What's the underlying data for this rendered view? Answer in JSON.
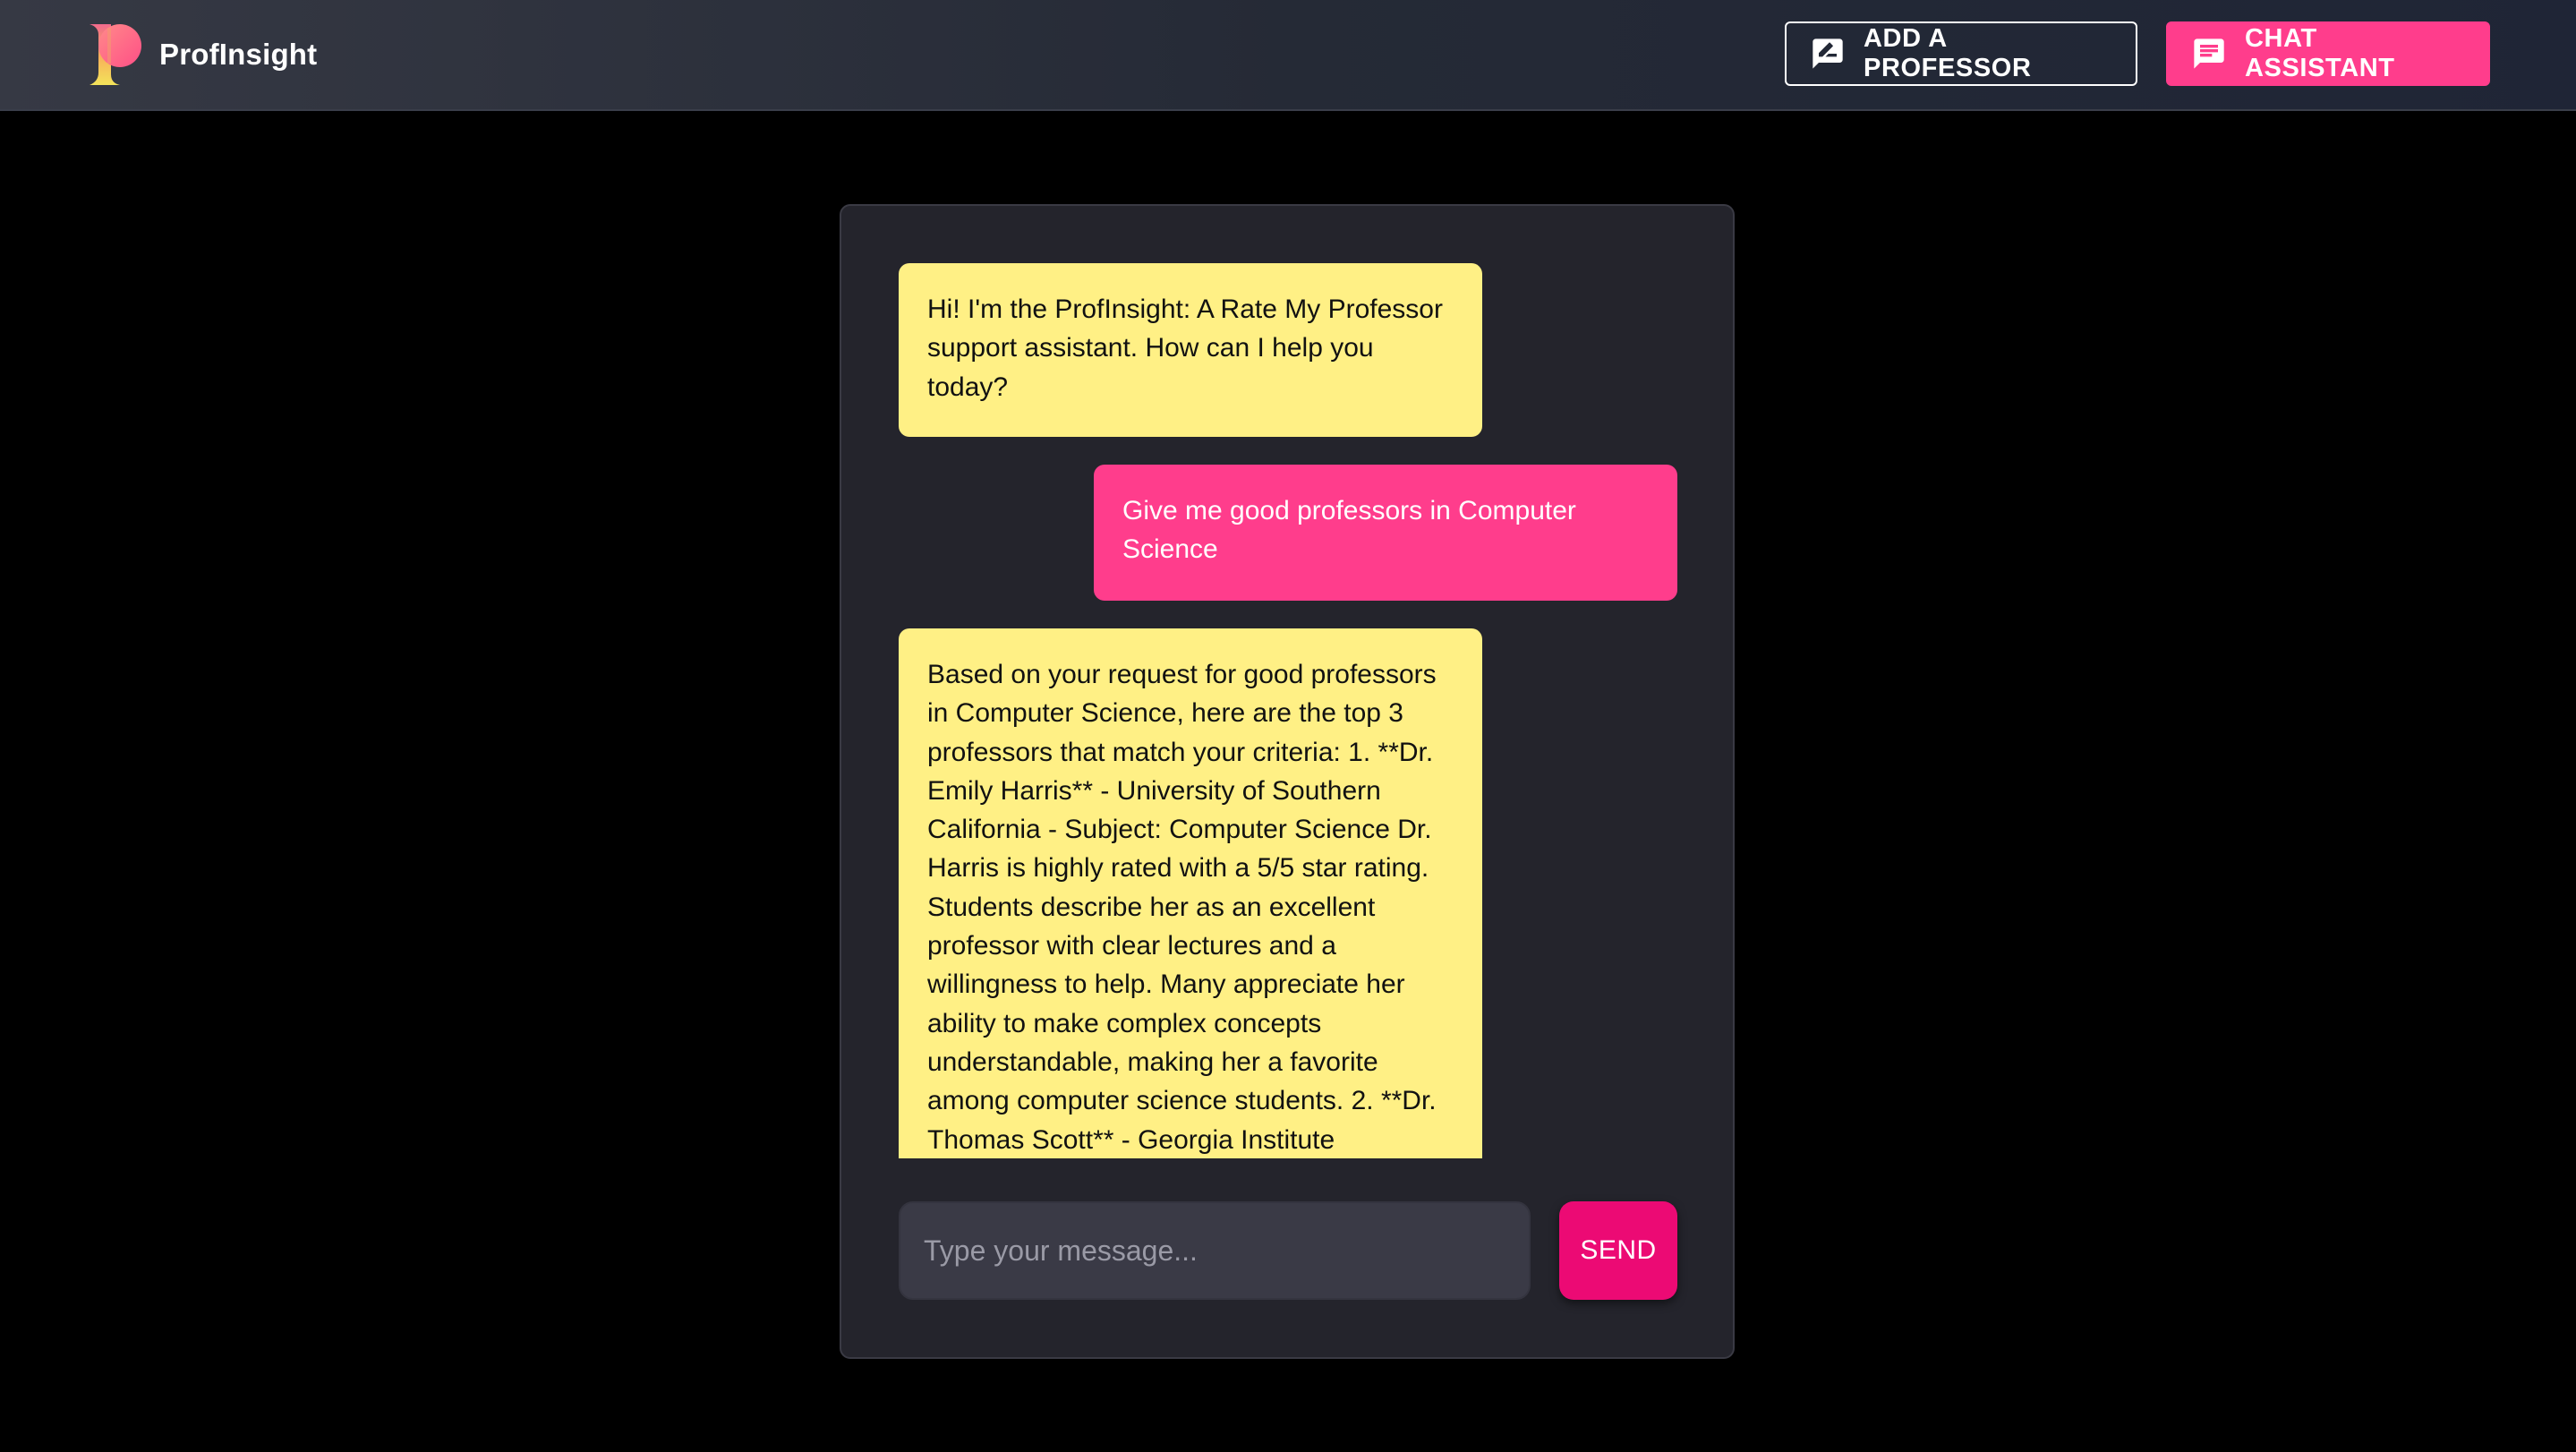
{
  "navbar": {
    "brand_name": "ProfInsight",
    "add_professor_label": "ADD A PROFESSOR",
    "chat_assistant_label": "CHAT ASSISTANT",
    "accent_color": "#ff3d8c",
    "icons": {
      "logo": "profinsight-p-logo",
      "add_professor": "rate-review-icon",
      "chat_assistant": "chat-bubble-icon"
    }
  },
  "chat": {
    "messages": [
      {
        "role": "assistant",
        "text": "Hi! I'm the ProfInsight: A Rate My Professor support assistant. How can I help you today?"
      },
      {
        "role": "user",
        "text": "Give me good professors in Computer Science"
      },
      {
        "role": "assistant",
        "text": "Based on your request for good professors in Computer Science, here are the top 3 professors that match your criteria: 1. **Dr. Emily Harris** - University of Southern California - Subject: Computer Science Dr. Harris is highly rated with a 5/5 star rating. Students describe her as an excellent professor with clear lectures and a willingness to help. Many appreciate her ability to make complex concepts understandable, making her a favorite among computer science students. 2. **Dr. Thomas Scott** - Georgia Institute"
      }
    ],
    "assistant_bubble_color": "#fff085",
    "user_bubble_color": "#ff3d8c",
    "input": {
      "placeholder": "Type your message...",
      "value": ""
    },
    "send_label": "SEND"
  }
}
